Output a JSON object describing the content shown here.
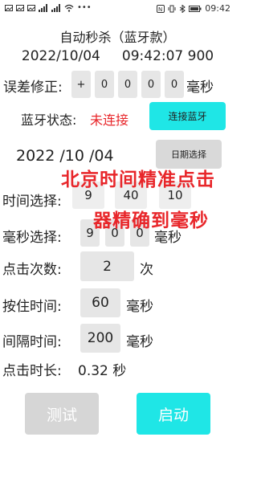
{
  "status_bar": {
    "left_icons": [
      "image-icon",
      "image-icon",
      "image-icon",
      "signal-icon",
      "signal-icon",
      "wifi-icon",
      "more-icon"
    ],
    "right_icons": [
      "nfc-icon",
      "vibrate-icon",
      "bluetooth-icon",
      "battery-icon"
    ],
    "time": "09:42"
  },
  "header": {
    "title": "自动秒杀（蓝牙款）",
    "datetime": "2022/10/04     09:42:07 900"
  },
  "error_correction": {
    "label": "误差修正:",
    "sign": "+",
    "digits": [
      "0",
      "0",
      "0",
      "0"
    ],
    "unit": "毫秒"
  },
  "bluetooth": {
    "label": "蓝牙状态:",
    "status": "未连接",
    "status_color": "#e8262a",
    "connect_button": "连接蓝牙"
  },
  "date": {
    "value": "2022 /10 /04",
    "select_button": "日期选择"
  },
  "time_select": {
    "label": "时间选择:",
    "hour": "9",
    "minute": "40",
    "second": "10"
  },
  "ms_select": {
    "label": "毫秒选择:",
    "digits": [
      "9",
      "0",
      "0"
    ],
    "unit": "毫秒"
  },
  "overlay": {
    "line1": "北京时间精准点击",
    "line2": "器精确到毫秒",
    "color": "#e8262a"
  },
  "click_count": {
    "label": "点击次数:",
    "value": "2",
    "unit": "次"
  },
  "hold_time": {
    "label": "按住时间:",
    "value": "60",
    "unit": "毫秒"
  },
  "interval_time": {
    "label": "间隔时间:",
    "value": "200",
    "unit": "毫秒"
  },
  "click_duration": {
    "label": "点击时长:",
    "value": "0.32 秒"
  },
  "actions": {
    "test_button": "测试",
    "start_button": "启动",
    "accent": "#1fe6e6"
  }
}
